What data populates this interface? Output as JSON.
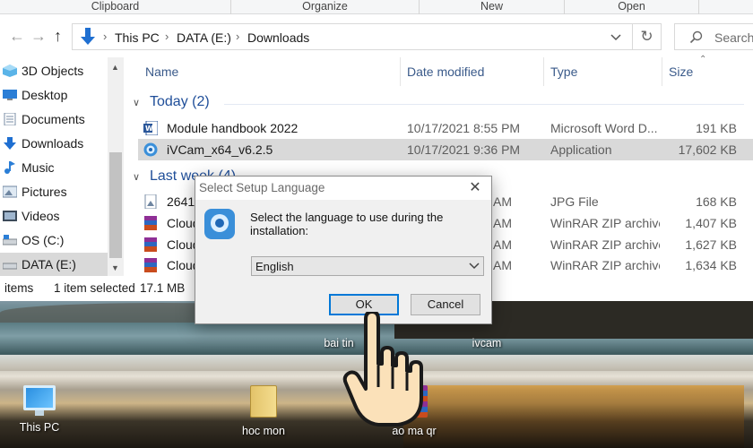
{
  "ribbon": {
    "groups": [
      "Clipboard",
      "Organize",
      "New",
      "Open"
    ]
  },
  "address": {
    "back_icon": "arrow-left",
    "forward_icon": "arrow-right",
    "up_icon": "arrow-up",
    "crumbs": [
      "This PC",
      "DATA (E:)",
      "Downloads"
    ],
    "search_placeholder": "Search"
  },
  "nav": {
    "items": [
      {
        "label": "3D Objects",
        "icon": "3d-objects"
      },
      {
        "label": "Desktop",
        "icon": "desktop"
      },
      {
        "label": "Documents",
        "icon": "documents"
      },
      {
        "label": "Downloads",
        "icon": "downloads"
      },
      {
        "label": "Music",
        "icon": "music"
      },
      {
        "label": "Pictures",
        "icon": "pictures"
      },
      {
        "label": "Videos",
        "icon": "videos"
      },
      {
        "label": "OS (C:)",
        "icon": "drive"
      },
      {
        "label": "DATA (E:)",
        "icon": "drive",
        "selected": true
      }
    ]
  },
  "list": {
    "columns": [
      "Name",
      "Date modified",
      "Type",
      "Size"
    ],
    "groups": [
      {
        "label": "Today (2)",
        "rows": [
          {
            "name": "Module handbook 2022",
            "date": "10/17/2021 8:55 PM",
            "type": "Microsoft Word D...",
            "size": "191 KB",
            "icon": "word"
          },
          {
            "name": "iVCam_x64_v6.2.5",
            "date": "10/17/2021 9:36 PM",
            "type": "Application",
            "size": "17,602 KB",
            "icon": "ivcam",
            "selected": true
          }
        ]
      },
      {
        "label": "Last week (4)",
        "rows": [
          {
            "name": "2641c",
            "date": "AM",
            "type": "JPG File",
            "size": "168 KB",
            "icon": "jpg"
          },
          {
            "name": "Cloud",
            "date": "AM",
            "type": "WinRAR ZIP archive",
            "size": "1,407 KB",
            "icon": "winrar"
          },
          {
            "name": "Cloud",
            "date": "AM",
            "type": "WinRAR ZIP archive",
            "size": "1,627 KB",
            "icon": "winrar"
          },
          {
            "name": "Cloud",
            "date": "AM",
            "type": "WinRAR ZIP archive",
            "size": "1,634 KB",
            "icon": "winrar"
          }
        ]
      }
    ]
  },
  "status": {
    "items": "items",
    "selected": "1 item selected",
    "size": "17.1 MB"
  },
  "dialog": {
    "title": "Select Setup Language",
    "prompt": "Select the language to use during the installation:",
    "language": "English",
    "ok": "OK",
    "cancel": "Cancel"
  },
  "desktop": {
    "icons": [
      {
        "label": "bai tin"
      },
      {
        "label": "ivcam"
      },
      {
        "label": "This PC"
      },
      {
        "label": "hoc mon"
      },
      {
        "label": "ao ma qr"
      }
    ]
  },
  "colors": {
    "accent": "#0078d7",
    "header_text": "#3a5a8a",
    "group_text": "#1f4e99",
    "selection": "#d9d9d9"
  }
}
